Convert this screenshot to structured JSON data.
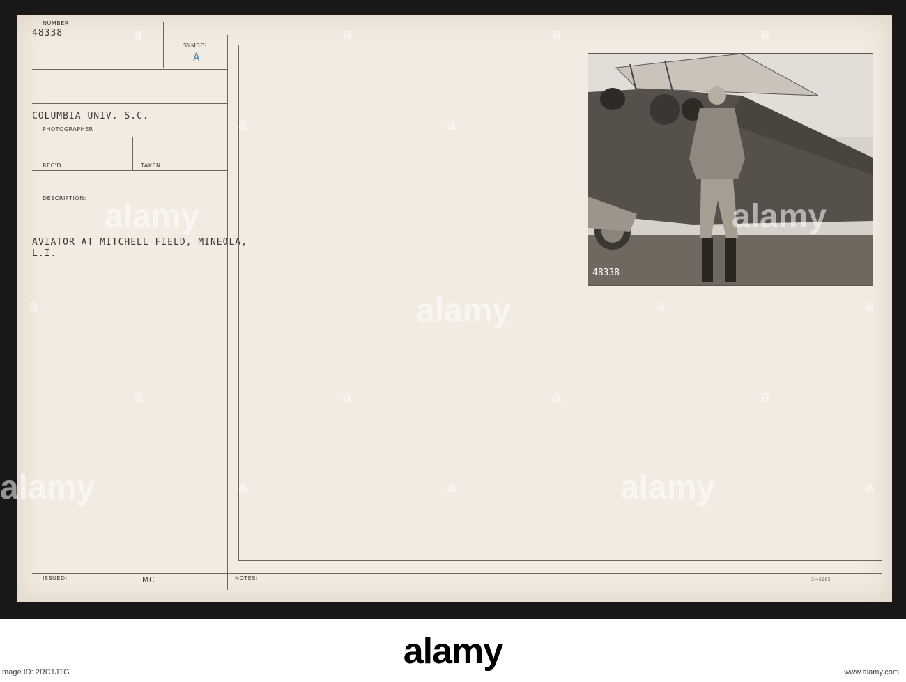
{
  "card": {
    "number_label": "NUMBER",
    "number_value": "48338",
    "symbol_label": "SYMBOL",
    "symbol_value": "A",
    "photographer_value": "COLUMBIA UNIV. S.C.",
    "photographer_label": "PHOTOGRAPHER",
    "recd_label": "REC'D",
    "taken_label": "TAKEN",
    "description_label": "DESCRIPTION:",
    "description_line1": "AVIATOR AT MITCHELL FIELD, MINEOLA,",
    "description_line2": "L.I.",
    "issued_label": "ISSUED:",
    "issued_value": "MC",
    "notes_label": "NOTES:",
    "form_number": "3—5605"
  },
  "photo": {
    "caption_number": "48338",
    "subject": "aviator standing beside biplane"
  },
  "watermark": {
    "text": "alamy",
    "mark": "a"
  },
  "footer": {
    "logo": "alamy",
    "image_id": "Image ID: 2RC1JTG",
    "url": "www.alamy.com"
  },
  "colors": {
    "card": "#f2ebe1",
    "ink": "#3c3833",
    "symbol": "#4f8aa8",
    "band": "#1a1816"
  }
}
